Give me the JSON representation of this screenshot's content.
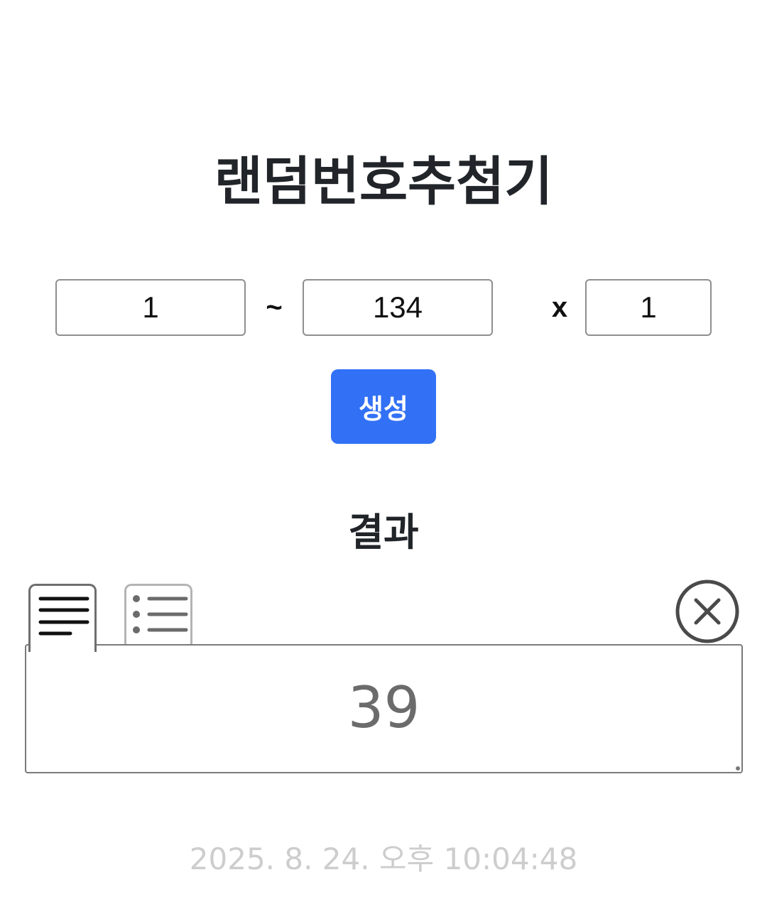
{
  "app": {
    "title": "랜덤번호추첨기"
  },
  "range": {
    "min_value": "1",
    "separator": "~",
    "max_value": "134",
    "times_symbol": "x",
    "count_value": "1"
  },
  "actions": {
    "generate_label": "생성"
  },
  "result": {
    "heading": "결과",
    "tabs": [
      {
        "icon": "text-lines-icon",
        "active": true
      },
      {
        "icon": "bulleted-list-icon",
        "active": false
      }
    ],
    "clear_icon": "close-circle-icon",
    "value": "39"
  },
  "footer": {
    "timestamp": "2025. 8. 24. 오후 10:04:48"
  },
  "colors": {
    "accent": "#3271f5",
    "text": "#212529",
    "muted": "#cdcdcd"
  }
}
